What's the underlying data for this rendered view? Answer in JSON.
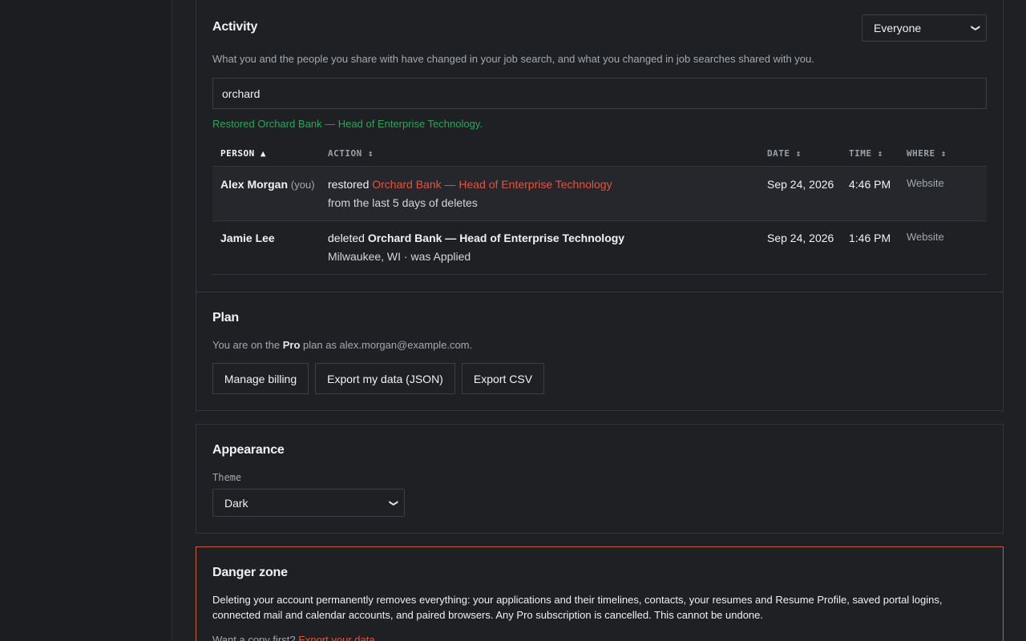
{
  "activity": {
    "title": "Activity",
    "filter_value": "Everyone",
    "description": "What you and the people you share with have changed in your job search, and what you changed in job searches shared with you.",
    "search_value": "orchard",
    "success_message": "Restored Orchard Bank — Head of Enterprise Technology.",
    "columns": {
      "person": "PERSON ▲",
      "action": "ACTION ↕",
      "date": "DATE ↕",
      "time": "TIME ↕",
      "where": "WHERE ↕"
    },
    "rows": [
      {
        "person": "Alex Morgan",
        "person_suffix": "(you)",
        "verb": "restored",
        "target": "Orchard Bank — Head of Enterprise Technology",
        "detail": "from the last 5 days of deletes",
        "date": "Sep 24, 2026",
        "time": "4:46 PM",
        "where": "Website"
      },
      {
        "person": "Jamie Lee",
        "verb": "deleted",
        "target": "Orchard Bank — Head of Enterprise Technology",
        "detail": "Milwaukee, WI · was Applied",
        "date": "Sep 24, 2026",
        "time": "1:46 PM",
        "where": "Website"
      }
    ]
  },
  "plan": {
    "title": "Plan",
    "text_prefix": "You are on the",
    "plan_name": "Pro",
    "text_suffix": "plan as alex.morgan@example.com.",
    "buttons": {
      "manage_billing": "Manage billing",
      "export_json": "Export my data (JSON)",
      "export_csv": "Export CSV"
    }
  },
  "appearance": {
    "title": "Appearance",
    "theme_label": "Theme",
    "theme_value": "Dark"
  },
  "danger": {
    "title": "Danger zone",
    "description": "Deleting your account permanently removes everything: your applications and their timelines, contacts, your resumes and Resume Profile, saved portal logins, connected mail and calendar accounts, and paired browsers. Any Pro subscription is cancelled. This cannot be undone.",
    "copy_prompt": "Want a copy first?",
    "export_link": "Export your data"
  },
  "colors": {
    "background": "#1e2024",
    "success": "#2fa35a",
    "link_red": "#e5533f",
    "danger_border": "#c7603f"
  }
}
